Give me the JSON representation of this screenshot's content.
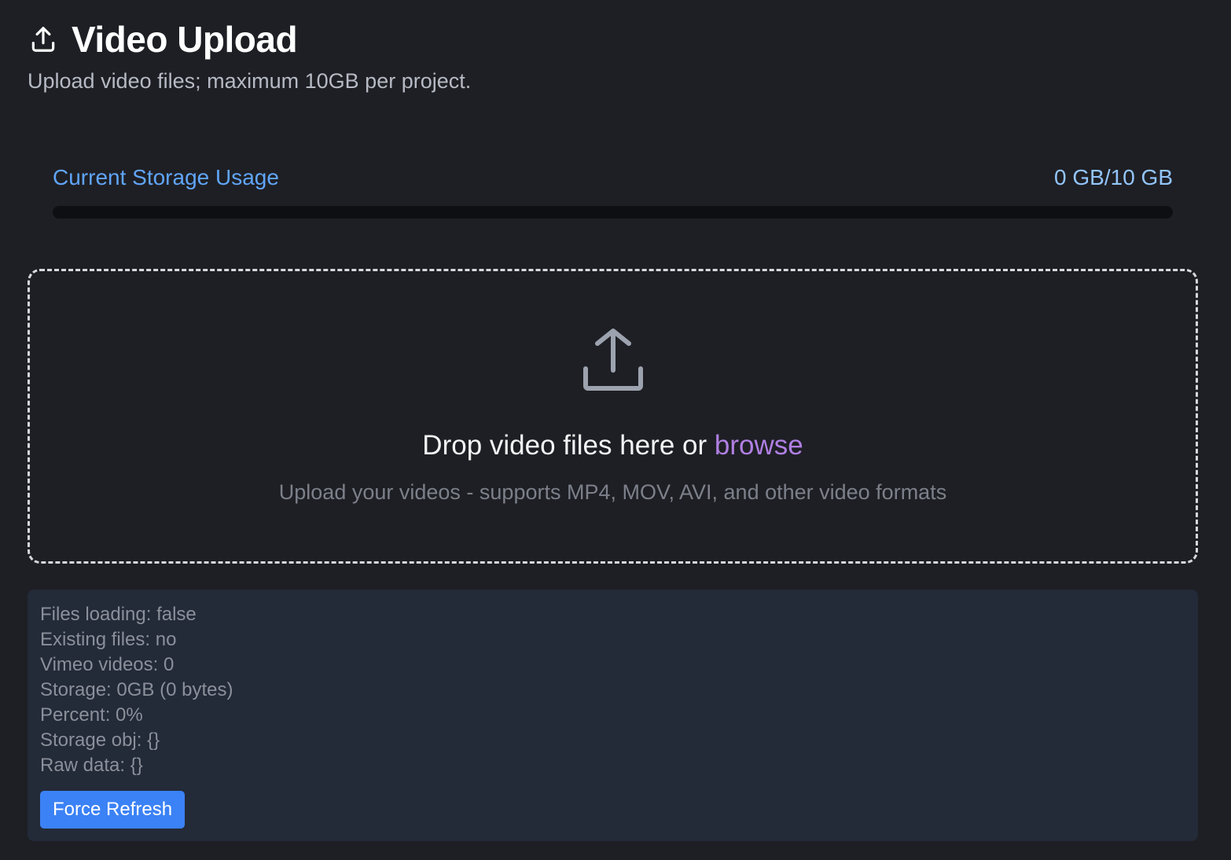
{
  "header": {
    "icon": "upload-icon",
    "title": "Video Upload",
    "subtitle": "Upload video files; maximum 10GB per project."
  },
  "storage": {
    "label": "Current Storage Usage",
    "value": "0 GB/10 GB",
    "percent": 0,
    "bar_fill_color": "#3b82f6",
    "label_color": "#60a5fa"
  },
  "dropzone": {
    "icon": "upload-tray-icon",
    "title_prefix": "Drop video files here or ",
    "browse_label": "browse",
    "hint": "Upload your videos - supports MP4, MOV, AVI, and other video formats",
    "browse_color": "#b07fe3"
  },
  "debug": {
    "lines": [
      "Files loading: false",
      "Existing files: no",
      "Vimeo videos: 0",
      "Storage: 0GB (0 bytes)",
      "Percent: 0%",
      "Storage obj: {}",
      "Raw data: {}"
    ],
    "refresh_label": "Force Refresh",
    "button_color": "#3b82f6"
  }
}
